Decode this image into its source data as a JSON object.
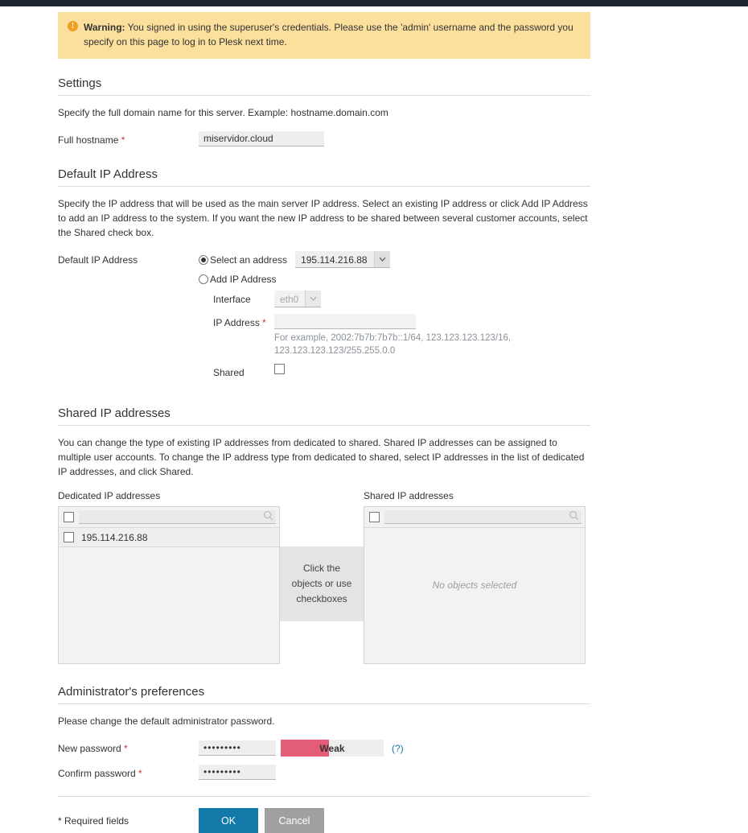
{
  "warning": {
    "icon": "warning-exclamation-icon",
    "bold_prefix": "Warning:",
    "text": " You signed in using the superuser's credentials. Please use the 'admin' username and the password you specify on this page to log in to Plesk next time."
  },
  "settings": {
    "heading": "Settings",
    "description": "Specify the full domain name for this server. Example: hostname.domain.com",
    "hostname_label": "Full hostname",
    "hostname_value": "miservidor.cloud",
    "hostname_placeholder": ""
  },
  "default_ip": {
    "heading": "Default IP Address",
    "description": "Specify the IP address that will be used as the main server IP address. Select an existing IP address or click Add IP Address to add an IP address to the system. If you want the new IP address to be shared between several customer accounts, select the Shared check box.",
    "row_label": "Default IP Address",
    "option_select_label": "Select an address",
    "option_select_checked": true,
    "address_value": "195.114.216.88",
    "address_options": [
      "195.114.216.88"
    ],
    "option_add_label": "Add IP Address",
    "option_add_checked": false,
    "interface_label": "Interface",
    "interface_value": "eth0",
    "interface_options": [
      "eth0"
    ],
    "ip_label": "IP Address",
    "ip_value": "",
    "ip_placeholder": "",
    "ip_hint": "For example, 2002:7b7b:7b7b::1/64, 123.123.123.123/16, 123.123.123.123/255.255.0.0",
    "shared_label": "Shared",
    "shared_checked": false
  },
  "shared_ips": {
    "heading": "Shared IP addresses",
    "description": "You can change the type of existing IP addresses from dedicated to shared. Shared IP addresses can be assigned to multiple user accounts. To change the IP address type from dedicated to shared, select IP addresses in the list of dedicated IP addresses, and click Shared.",
    "dedicated_title": "Dedicated IP addresses",
    "dedicated_search_value": "",
    "dedicated_search_placeholder": "",
    "dedicated_items": [
      "195.114.216.88"
    ],
    "middle_hint": "Click the objects or use checkboxes",
    "shared_title": "Shared IP addresses",
    "shared_search_value": "",
    "shared_search_placeholder": "",
    "shared_empty_text": "No objects selected"
  },
  "admin_prefs": {
    "heading": "Administrator's preferences",
    "description": "Please change the default administrator password.",
    "new_password_label": "New password",
    "new_password_value": "•••••••••",
    "strength_label": "Weak",
    "strength_percent": 47,
    "strength_color": "#e35d78",
    "help_label": "(?)",
    "confirm_password_label": "Confirm password",
    "confirm_password_value": "•••••••••"
  },
  "footer": {
    "required_note": "* Required fields",
    "ok_label": "OK",
    "cancel_label": "Cancel",
    "ok_color": "#1279a8",
    "cancel_color": "#a0a0a0"
  }
}
